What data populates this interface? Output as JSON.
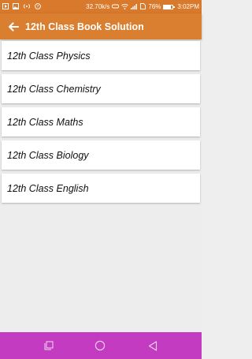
{
  "status_bar": {
    "network_speed": "32.70k/s",
    "battery_percent": "76%",
    "time": "3:02PM",
    "battery_level": 0.76,
    "icons": [
      "media-icon",
      "gallery-icon",
      "hotspot-icon",
      "help-circle-icon",
      "vr-icon",
      "wifi-icon",
      "signal-icon",
      "sim-icon",
      "battery-icon"
    ]
  },
  "app_bar": {
    "title": "12th Class Book Solution",
    "back_icon": "back-arrow-icon",
    "background": "#da7f30"
  },
  "subjects": [
    {
      "label": "12th Class Physics"
    },
    {
      "label": "12th Class Chemistry"
    },
    {
      "label": "12th Class Maths"
    },
    {
      "label": "12th Class Biology"
    },
    {
      "label": "12th Class English"
    }
  ],
  "nav_bar": {
    "background": "#c23bc0",
    "buttons": [
      "recents-icon",
      "home-icon",
      "back-icon"
    ]
  }
}
